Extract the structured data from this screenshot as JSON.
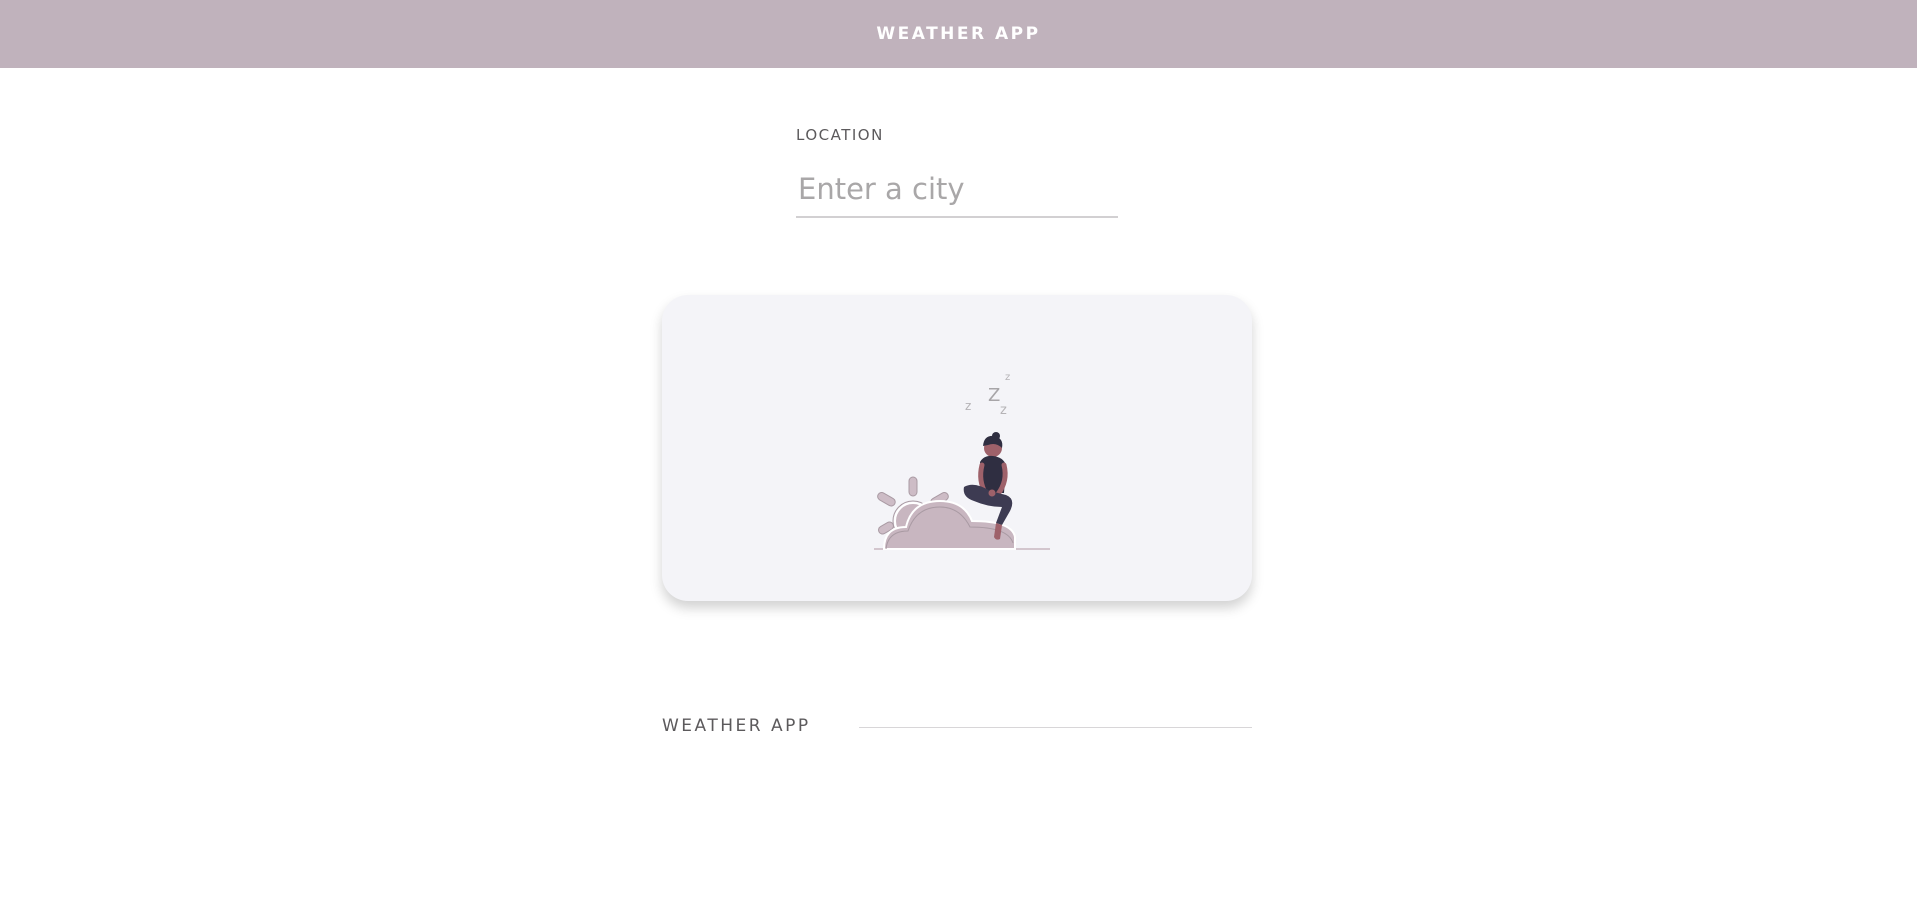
{
  "header": {
    "title": "WEATHER APP"
  },
  "search": {
    "label": "LOCATION",
    "placeholder": "Enter a city",
    "value": ""
  },
  "illustration": {
    "description_icon": "sleeping-person-on-cloud-illustration",
    "sleep_marks": [
      "z",
      "Z",
      "z",
      "z"
    ]
  },
  "footer": {
    "title": "WEATHER APP"
  },
  "colors": {
    "header_bg": "#c0b2bc",
    "card_bg": "#f4f4f8",
    "cloud": "#c8b6c0",
    "person_dark": "#2f2e41",
    "skin": "#9e616a"
  }
}
